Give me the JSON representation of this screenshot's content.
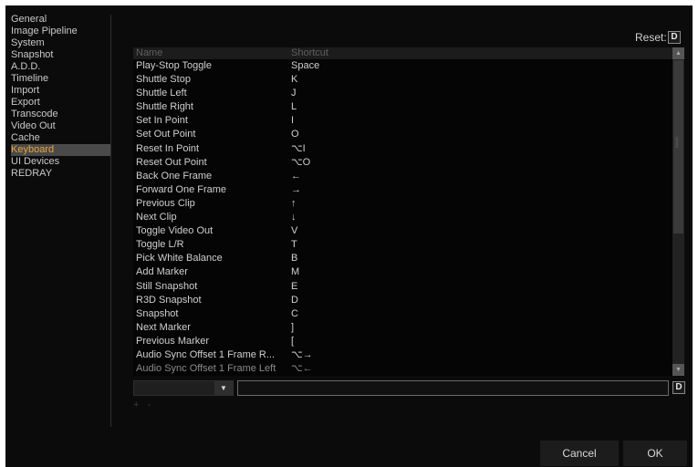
{
  "sidebar": {
    "items": [
      {
        "label": "General"
      },
      {
        "label": "Image Pipeline"
      },
      {
        "label": "System"
      },
      {
        "label": "Snapshot"
      },
      {
        "label": "A.D.D."
      },
      {
        "label": "Timeline"
      },
      {
        "label": "Import"
      },
      {
        "label": "Export"
      },
      {
        "label": "Transcode"
      },
      {
        "label": "Video Out"
      },
      {
        "label": "Cache"
      },
      {
        "label": "Keyboard",
        "active": true
      },
      {
        "label": "UI Devices"
      },
      {
        "label": "REDRAY"
      }
    ]
  },
  "reset": {
    "label": "Reset:",
    "button": "D"
  },
  "table": {
    "headers": {
      "name": "Name",
      "shortcut": "Shortcut"
    },
    "rows": [
      {
        "name": "Play-Stop Toggle",
        "shortcut": "Space"
      },
      {
        "name": "Shuttle Stop",
        "shortcut": "K"
      },
      {
        "name": "Shuttle Left",
        "shortcut": "J"
      },
      {
        "name": "Shuttle Right",
        "shortcut": "L"
      },
      {
        "name": "Set In Point",
        "shortcut": "I"
      },
      {
        "name": "Set Out Point",
        "shortcut": "O"
      },
      {
        "name": "Reset In Point",
        "shortcut": "⌥I"
      },
      {
        "name": "Reset Out Point",
        "shortcut": "⌥O"
      },
      {
        "name": "Back One Frame",
        "shortcut": "←"
      },
      {
        "name": "Forward One Frame",
        "shortcut": "→"
      },
      {
        "name": "Previous Clip",
        "shortcut": "↑"
      },
      {
        "name": "Next Clip",
        "shortcut": "↓"
      },
      {
        "name": "Toggle Video Out",
        "shortcut": "V"
      },
      {
        "name": "Toggle L/R",
        "shortcut": "T"
      },
      {
        "name": "Pick White Balance",
        "shortcut": "B"
      },
      {
        "name": "Add Marker",
        "shortcut": "M"
      },
      {
        "name": "Still Snapshot",
        "shortcut": "E"
      },
      {
        "name": "R3D Snapshot",
        "shortcut": "D"
      },
      {
        "name": "Snapshot",
        "shortcut": "C"
      },
      {
        "name": "Next Marker",
        "shortcut": "]"
      },
      {
        "name": "Previous Marker",
        "shortcut": "["
      },
      {
        "name": "Audio Sync Offset 1 Frame R...",
        "shortcut": "⌥→"
      },
      {
        "name": "Audio Sync Offset 1 Frame Left",
        "shortcut": "⌥←"
      }
    ]
  },
  "editor": {
    "field_button": "D",
    "add_label": "+",
    "remove_label": "-"
  },
  "footer": {
    "cancel": "Cancel",
    "ok": "OK"
  },
  "icons": {
    "scroll_up": "triangle-up",
    "scroll_down": "triangle-down",
    "combo_arrow": "triangle-down"
  }
}
